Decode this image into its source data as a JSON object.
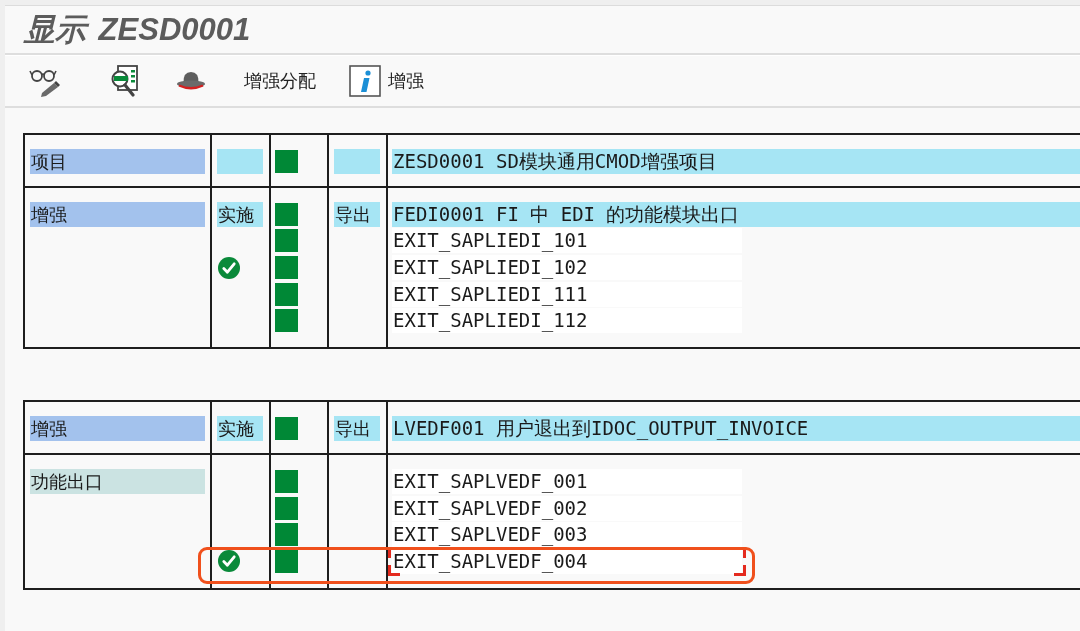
{
  "window": {
    "title": "显示 ZESD0001"
  },
  "toolbar": [
    {
      "kind": "text",
      "label": "增强分配"
    },
    {
      "kind": "info",
      "label": "增强"
    }
  ],
  "blocks": [
    {
      "rows": [
        {
          "kind": "header",
          "label": "项目",
          "lines": [
            {
              "kind": "title",
              "active": true,
              "text": "ZESD0001 SD模块通用CMOD增强项目"
            }
          ]
        },
        {
          "kind": "header",
          "label": "增强",
          "lines": [
            {
              "kind": "title",
              "tag": "实施",
              "active": true,
              "type": "导出",
              "text": "FEDI0001 FI 中 EDI 的功能模块出口"
            },
            {
              "kind": "exit",
              "implemented": false,
              "active": true,
              "focused": false,
              "highlighted": false,
              "text": "EXIT_SAPLIEDI_101"
            },
            {
              "kind": "exit",
              "implemented": true,
              "active": true,
              "focused": false,
              "highlighted": false,
              "text": "EXIT_SAPLIEDI_102"
            },
            {
              "kind": "exit",
              "implemented": false,
              "active": true,
              "focused": false,
              "highlighted": false,
              "text": "EXIT_SAPLIEDI_111"
            },
            {
              "kind": "exit",
              "implemented": false,
              "active": true,
              "focused": false,
              "highlighted": false,
              "text": "EXIT_SAPLIEDI_112"
            }
          ]
        }
      ]
    },
    {
      "rows": [
        {
          "kind": "header",
          "label": "增强",
          "lines": [
            {
              "kind": "title",
              "tag": "实施",
              "active": true,
              "type": "导出",
              "text": "LVEDF001 用户退出到IDOC_OUTPUT_INVOICE"
            }
          ]
        },
        {
          "kind": "sub",
          "label": "功能出口",
          "lines": [
            {
              "kind": "exit",
              "implemented": false,
              "active": true,
              "focused": false,
              "highlighted": false,
              "text": "EXIT_SAPLVEDF_001"
            },
            {
              "kind": "exit",
              "implemented": false,
              "active": true,
              "focused": false,
              "highlighted": false,
              "text": "EXIT_SAPLVEDF_002"
            },
            {
              "kind": "exit",
              "implemented": false,
              "active": true,
              "focused": false,
              "highlighted": false,
              "text": "EXIT_SAPLVEDF_003"
            },
            {
              "kind": "exit",
              "implemented": true,
              "active": true,
              "focused": true,
              "highlighted": true,
              "text": "EXIT_SAPLVEDF_004"
            }
          ]
        }
      ]
    }
  ]
}
